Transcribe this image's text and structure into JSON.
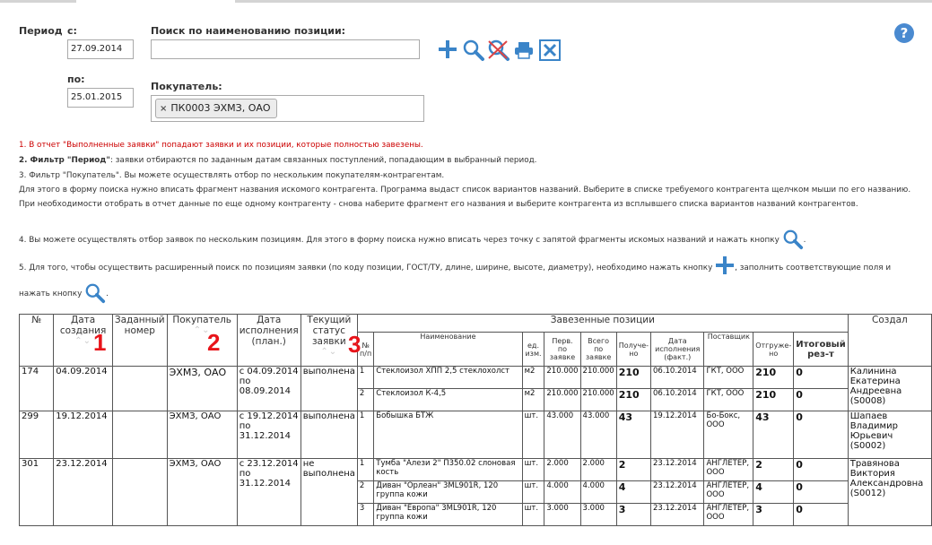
{
  "filters": {
    "period_label": "Период",
    "from_label": "с:",
    "from_value": "27.09.2014",
    "to_label": "по:",
    "to_value": "25.01.2015",
    "search_label": "Поиск по наименованию позиции:",
    "search_value": "",
    "buyer_label": "Покупатель:",
    "buyer_tag": "ПК0003 ЭХМЗ, ОАО",
    "tag_remove": "×"
  },
  "toolbar": {
    "icons": [
      "plus-icon",
      "search-icon",
      "clear-search-icon",
      "print-icon",
      "excel-icon"
    ],
    "help_label": "?",
    "colors": {
      "icon_blue": "#3a84c8",
      "clear_red": "#d44"
    }
  },
  "notes": {
    "n1": "1. В отчет \"Выполненные заявки\" попадают заявки и их позиции, которые полностью завезены.",
    "n2_bold": "2. Фильтр \"Период\"",
    "n2_rest": ": заявки отбираются по заданным датам связанных поступлений, попадающим в выбранный период.",
    "n3": "3. Фильтр \"Покупатель\". Вы можете осуществлять отбор по нескольким покупателям-контрагентам.",
    "n3b": "Для этого в форму поиска нужно вписать фрагмент названия искомого контрагента. Программа выдаст список вариантов названий. Выберите в списке требуемого контрагента щелчком мыши по его названию.",
    "n3c": "При необходимости отобрать в отчет данные по еще одному контрагенту - снова наберите фрагмент его названия и выберите контрагента из всплывшего списка вариантов названий контрагентов.",
    "n4": "4. Вы можете осуществлять отбор заявок по нескольким позициям. Для этого в форму поиска нужно вписать через точку с запятой фрагменты искомых названий и нажать кнопку",
    "n4_end": ".",
    "n5": "5. Для того, чтобы осуществить расширенный поиск по позициям заявки (по коду позиции, ГОСТ/ТУ, длине, ширине, высоте, диаметру), необходимо нажать кнопку",
    "n5_mid": ", заполнить соответствующие поля и",
    "n5b": "нажать кнопку",
    "n5b_end": "."
  },
  "table": {
    "headers": {
      "num": "№",
      "created": "Дата создания",
      "given_num": "Заданный номер",
      "buyer": "Покупатель",
      "exec_date": "Дата исполнения (план.)",
      "status": "Текущий статус заявки",
      "delivered_group": "Завезенные позиции",
      "author": "Создал",
      "sub_num": "№ п/п",
      "sub_name": "Наименование",
      "sub_unit": "ед. изм.",
      "sub_first": "Перв. по заявке",
      "sub_total": "Всего по заявке",
      "sub_received": "Получе-но",
      "sub_exec_fact": "Дата исполнения (факт.)",
      "sub_supplier": "Поставщик",
      "sub_shipped": "Отгруже-но",
      "sub_result": "Итоговый рез-т",
      "sort_arrows": "⌃⌄"
    },
    "orders": [
      {
        "num": "174",
        "created": "04.09.2014",
        "given_num": "",
        "buyer": "ЭХМЗ, ОАО",
        "exec": "с 04.09.2014 по 08.09.2014",
        "status": "выполнена",
        "author": "Калинина Екатерина Андреевна (S0008)",
        "items": [
          {
            "n": "1",
            "name": "Стеклоизол ХПП 2,5 стеклохолст",
            "unit": "м2",
            "first": "210.000",
            "total": "210.000",
            "received": "210",
            "fact": "06.10.2014",
            "supplier": "ГКТ, ООО",
            "shipped": "210",
            "result": "0"
          },
          {
            "n": "2",
            "name": "Стеклоизол К-4,5",
            "unit": "м2",
            "first": "210.000",
            "total": "210.000",
            "received": "210",
            "fact": "06.10.2014",
            "supplier": "ГКТ, ООО",
            "shipped": "210",
            "result": "0"
          }
        ]
      },
      {
        "num": "299",
        "created": "19.12.2014",
        "given_num": "",
        "buyer": "ЭХМЗ, ОАО",
        "exec": "с 19.12.2014 по 31.12.2014",
        "status": "выполнена",
        "author": "Шапаев Владимир Юрьевич (S0002)",
        "items": [
          {
            "n": "1",
            "name": "Бобышка БТЖ",
            "unit": "шт.",
            "first": "43.000",
            "total": "43.000",
            "received": "43",
            "fact": "19.12.2014",
            "supplier": "Бо-Бокс, ООО",
            "shipped": "43",
            "result": "0"
          }
        ]
      },
      {
        "num": "301",
        "created": "23.12.2014",
        "given_num": "",
        "buyer": "ЭХМЗ, ОАО",
        "exec": "с 23.12.2014 по 31.12.2014",
        "status": "не выполнена",
        "author": "Травянова Виктория Александровна (S0012)",
        "items": [
          {
            "n": "1",
            "name": "Тумба \"Алези 2\" П350.02 слоновая кость",
            "unit": "шт.",
            "first": "2.000",
            "total": "2.000",
            "received": "2",
            "fact": "23.12.2014",
            "supplier": "АНГЛЕТЕР, ООО",
            "shipped": "2",
            "result": "0"
          },
          {
            "n": "2",
            "name": "Диван \"Орлеан\" 3ML901R, 120 группа кожи",
            "unit": "шт.",
            "first": "4.000",
            "total": "4.000",
            "received": "4",
            "fact": "23.12.2014",
            "supplier": "АНГЛЕТЕР, ООО",
            "shipped": "4",
            "result": "0"
          },
          {
            "n": "3",
            "name": "Диван \"Европа\" 3ML901R, 120 группа кожи",
            "unit": "шт.",
            "first": "3.000",
            "total": "3.000",
            "received": "3",
            "fact": "23.12.2014",
            "supplier": "АНГЛЕТЕР, ООО",
            "shipped": "3",
            "result": "0"
          }
        ]
      }
    ]
  },
  "annotations": {
    "a1": "1",
    "a2": "2",
    "a3": "3",
    "color": "#e8141a"
  }
}
